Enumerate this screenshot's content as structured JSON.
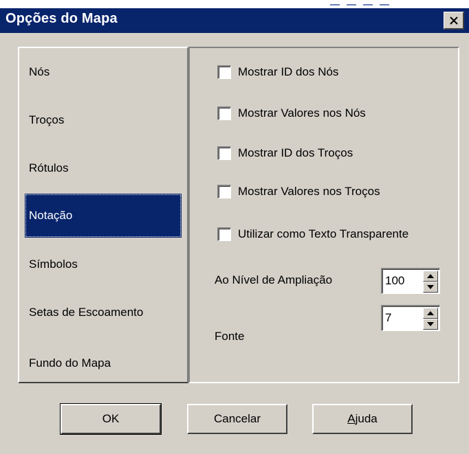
{
  "window": {
    "title": "Opções do Mapa",
    "close_glyph": "close-icon"
  },
  "nav": {
    "items": [
      {
        "label": "Nós"
      },
      {
        "label": "Troços"
      },
      {
        "label": "Rótulos"
      },
      {
        "label": "Notação",
        "selected": true
      },
      {
        "label": "Símbolos"
      },
      {
        "label": "Setas de Escoamento"
      },
      {
        "label": "Fundo do Mapa"
      }
    ]
  },
  "notation": {
    "checkboxes": [
      {
        "label": "Mostrar ID dos Nós",
        "checked": false
      },
      {
        "label": "Mostrar Valores nos Nós",
        "checked": false
      },
      {
        "label": "Mostrar ID dos Troços",
        "checked": false
      },
      {
        "label": "Mostrar Valores nos Troços",
        "checked": false
      },
      {
        "label": "Utilizar como Texto Transparente",
        "checked": false
      }
    ],
    "zoom_label": "Ao Nível de Ampliação",
    "zoom_value": "100",
    "font_label": "Fonte",
    "font_value": "7"
  },
  "buttons": {
    "ok": "OK",
    "cancel": "Cancelar",
    "help_prefix": "A",
    "help_rest": "juda"
  },
  "colors": {
    "titlebar": "#08246b",
    "selection": "#08246b",
    "face": "#d4d0c8"
  }
}
